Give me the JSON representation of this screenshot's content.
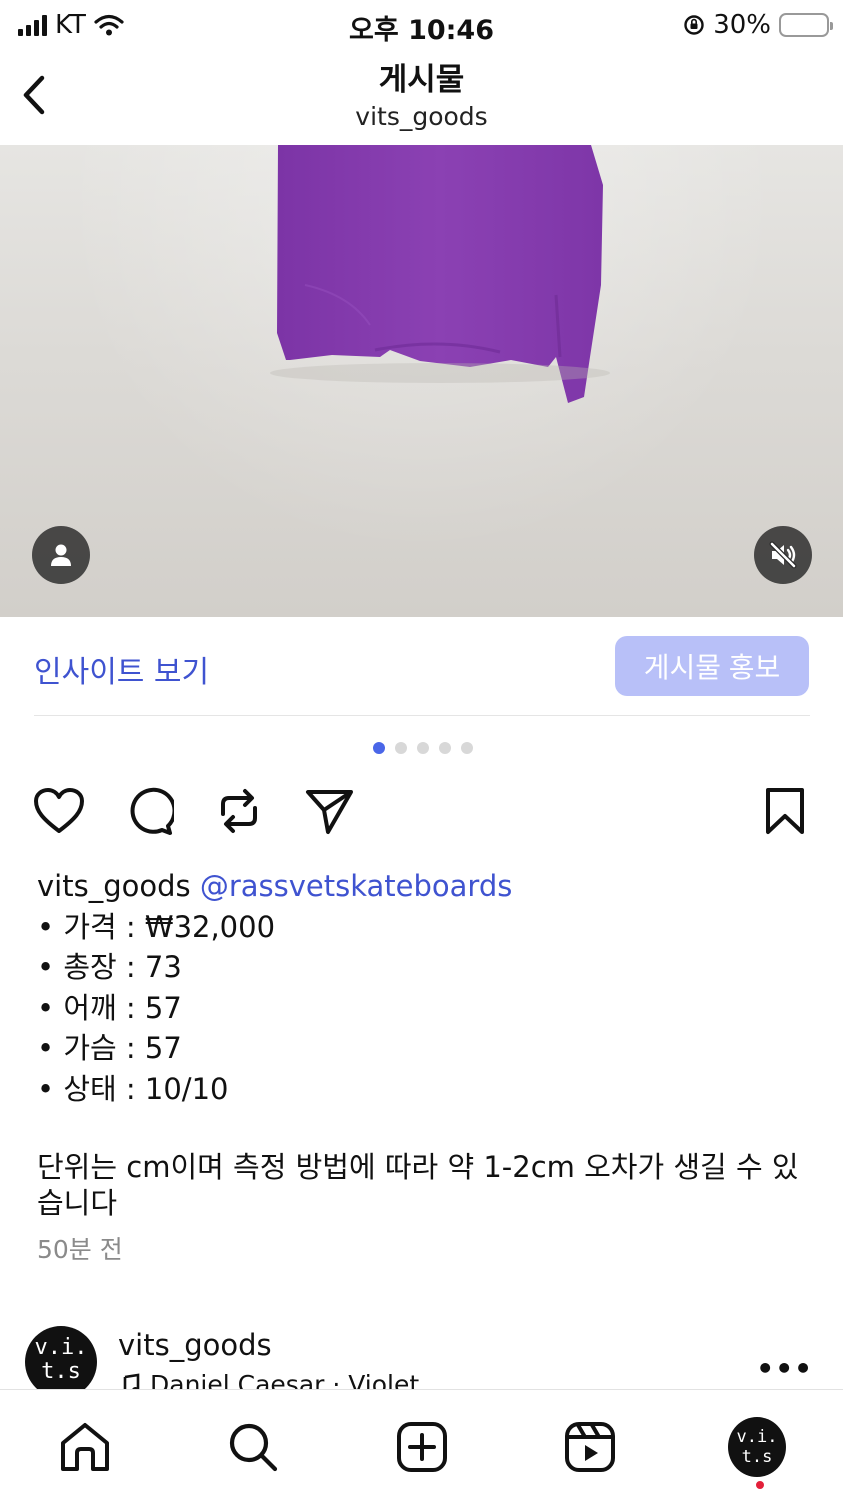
{
  "status_bar": {
    "carrier": "KT",
    "time": "오후 10:46",
    "battery_percent": "30%",
    "battery_level": 0.3
  },
  "header": {
    "title": "게시물",
    "subtitle": "vits_goods"
  },
  "media": {
    "shirt_color": "#8a3fb0",
    "wall_color": "#dedcd8",
    "sound_muted": true
  },
  "insight": {
    "insight_label": "인사이트 보기",
    "promote_label": "게시물 홍보",
    "accent": "#3f53d0"
  },
  "carousel": {
    "count": 5,
    "active_index": 0
  },
  "caption": {
    "username": "vits_goods",
    "mention": "@rassvetskateboards",
    "lines": [
      "• 가격 : ₩32,000",
      "• 총장 : 73",
      "• 어깨 : 57",
      "• 가슴 : 57",
      "• 상태 : 10/10"
    ],
    "note": "단위는 cm이며 측정 방법에 따라 약 1-2cm 오차가 생길 수 있습니다",
    "time_ago": "50분 전"
  },
  "next_post": {
    "avatar_text_line1": "v.i.",
    "avatar_text_line2": "t.s",
    "username": "vits_goods",
    "music": "Daniel Caesar · Violet",
    "more": "•••"
  },
  "tab_bar": {
    "avatar_text_line1": "v.i.",
    "avatar_text_line2": "t.s",
    "icons": [
      "home-icon",
      "search-icon",
      "create-icon",
      "reels-icon",
      "profile-avatar"
    ]
  }
}
